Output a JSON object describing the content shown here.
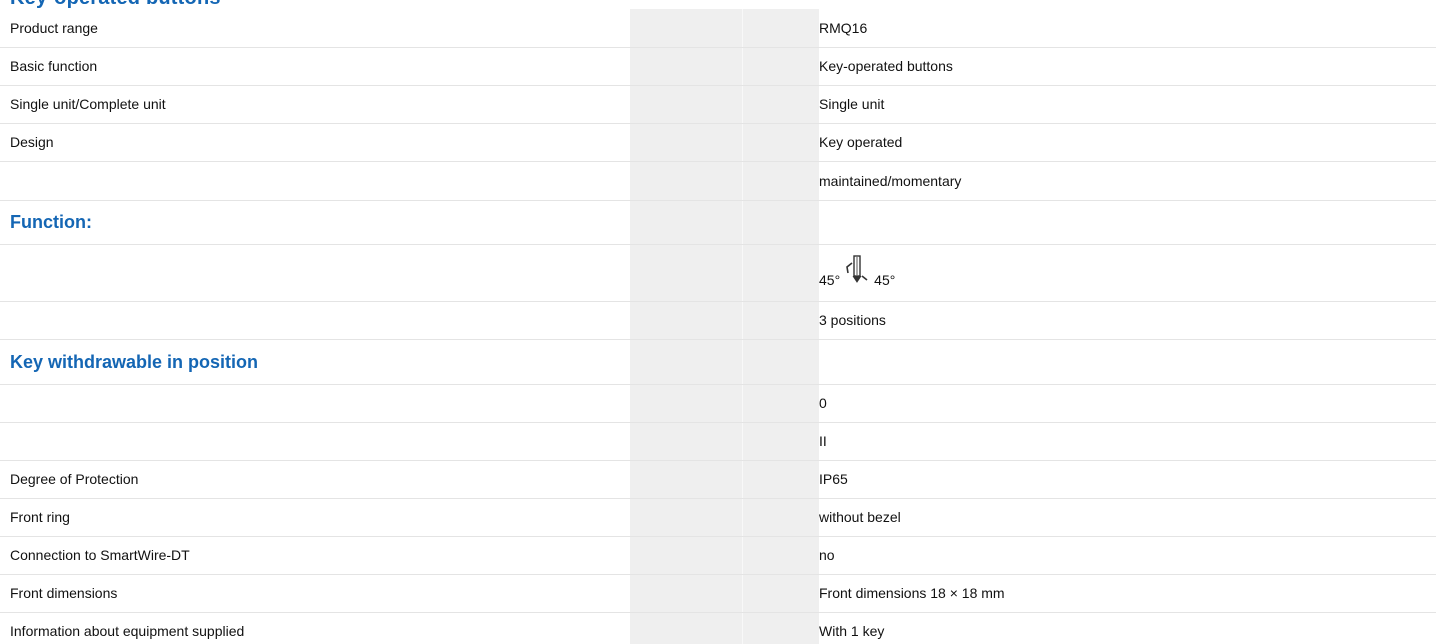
{
  "heading": "Key-operated buttons",
  "rows": [
    {
      "label": "Product range",
      "value": "RMQ16"
    },
    {
      "label": "Basic function",
      "value": "Key-operated buttons"
    },
    {
      "label": "Single unit/Complete unit",
      "value": "Single unit"
    },
    {
      "label": "Design",
      "value": "Key operated"
    },
    {
      "label": "",
      "value": "maintained/momentary"
    },
    {
      "label": "Function:",
      "value": ""
    },
    {
      "label": "",
      "value_left": "45°",
      "value_icon": "key-switch-symbol-icon",
      "value_right": "45°"
    },
    {
      "label": "",
      "value": "3 positions"
    },
    {
      "label": "Key withdrawable in position",
      "value": ""
    },
    {
      "label": "",
      "value": "0"
    },
    {
      "label": "",
      "value": "II"
    },
    {
      "label": "Degree of Protection",
      "value": "IP65"
    },
    {
      "label": "Front ring",
      "value": "without bezel"
    },
    {
      "label": "Connection to SmartWire-DT",
      "value": "no"
    },
    {
      "label": "Front dimensions",
      "value": "Front dimensions 18 × 18 mm"
    },
    {
      "label": "Information about equipment supplied",
      "value": "With 1 key"
    }
  ],
  "colors": {
    "section_heading": "#1466b4",
    "row_divider": "#e4e4e4",
    "gap_column": "#efefef"
  }
}
